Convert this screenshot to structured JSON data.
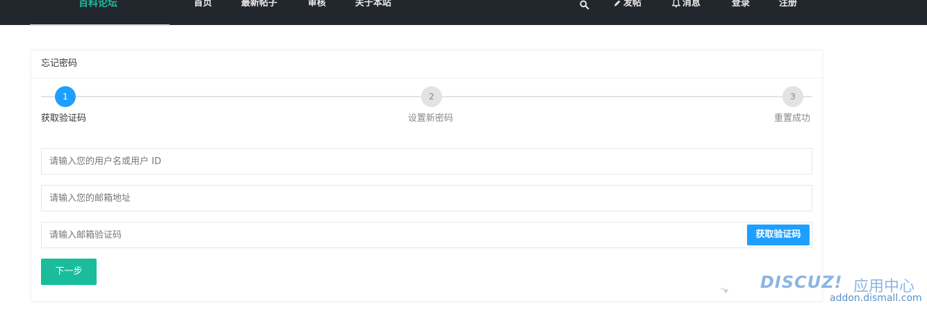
{
  "topbar": {
    "brand": "百科论坛",
    "nav": [
      {
        "label": "首页"
      },
      {
        "label": "最新帖子"
      },
      {
        "label": "审核"
      },
      {
        "label": "关于本站"
      }
    ],
    "actions": {
      "search_icon": "search-icon",
      "post_label": "发帖",
      "messages_label": "消息",
      "login_label": "登录",
      "register_label": "注册"
    }
  },
  "card": {
    "title": "忘记密码",
    "steps": [
      {
        "number": "1",
        "label": "获取验证码",
        "state": "active"
      },
      {
        "number": "2",
        "label": "设置新密码",
        "state": "idle"
      },
      {
        "number": "3",
        "label": "重置成功",
        "state": "idle"
      }
    ],
    "form": {
      "username_placeholder": "请输入您的用户名或用户 ID",
      "email_placeholder": "请输入您的邮箱地址",
      "code_placeholder": "请输入邮箱验证码",
      "get_code_label": "获取验证码",
      "next_label": "下一步"
    }
  },
  "watermark": {
    "brand": "DISCUZ!",
    "cn": "应用中心",
    "url": "addon.dismall.com"
  },
  "colors": {
    "topbar_bg": "#22262d",
    "brand": "#1abc9c",
    "primary": "#1e9fff",
    "next_button": "#1abc9c"
  }
}
